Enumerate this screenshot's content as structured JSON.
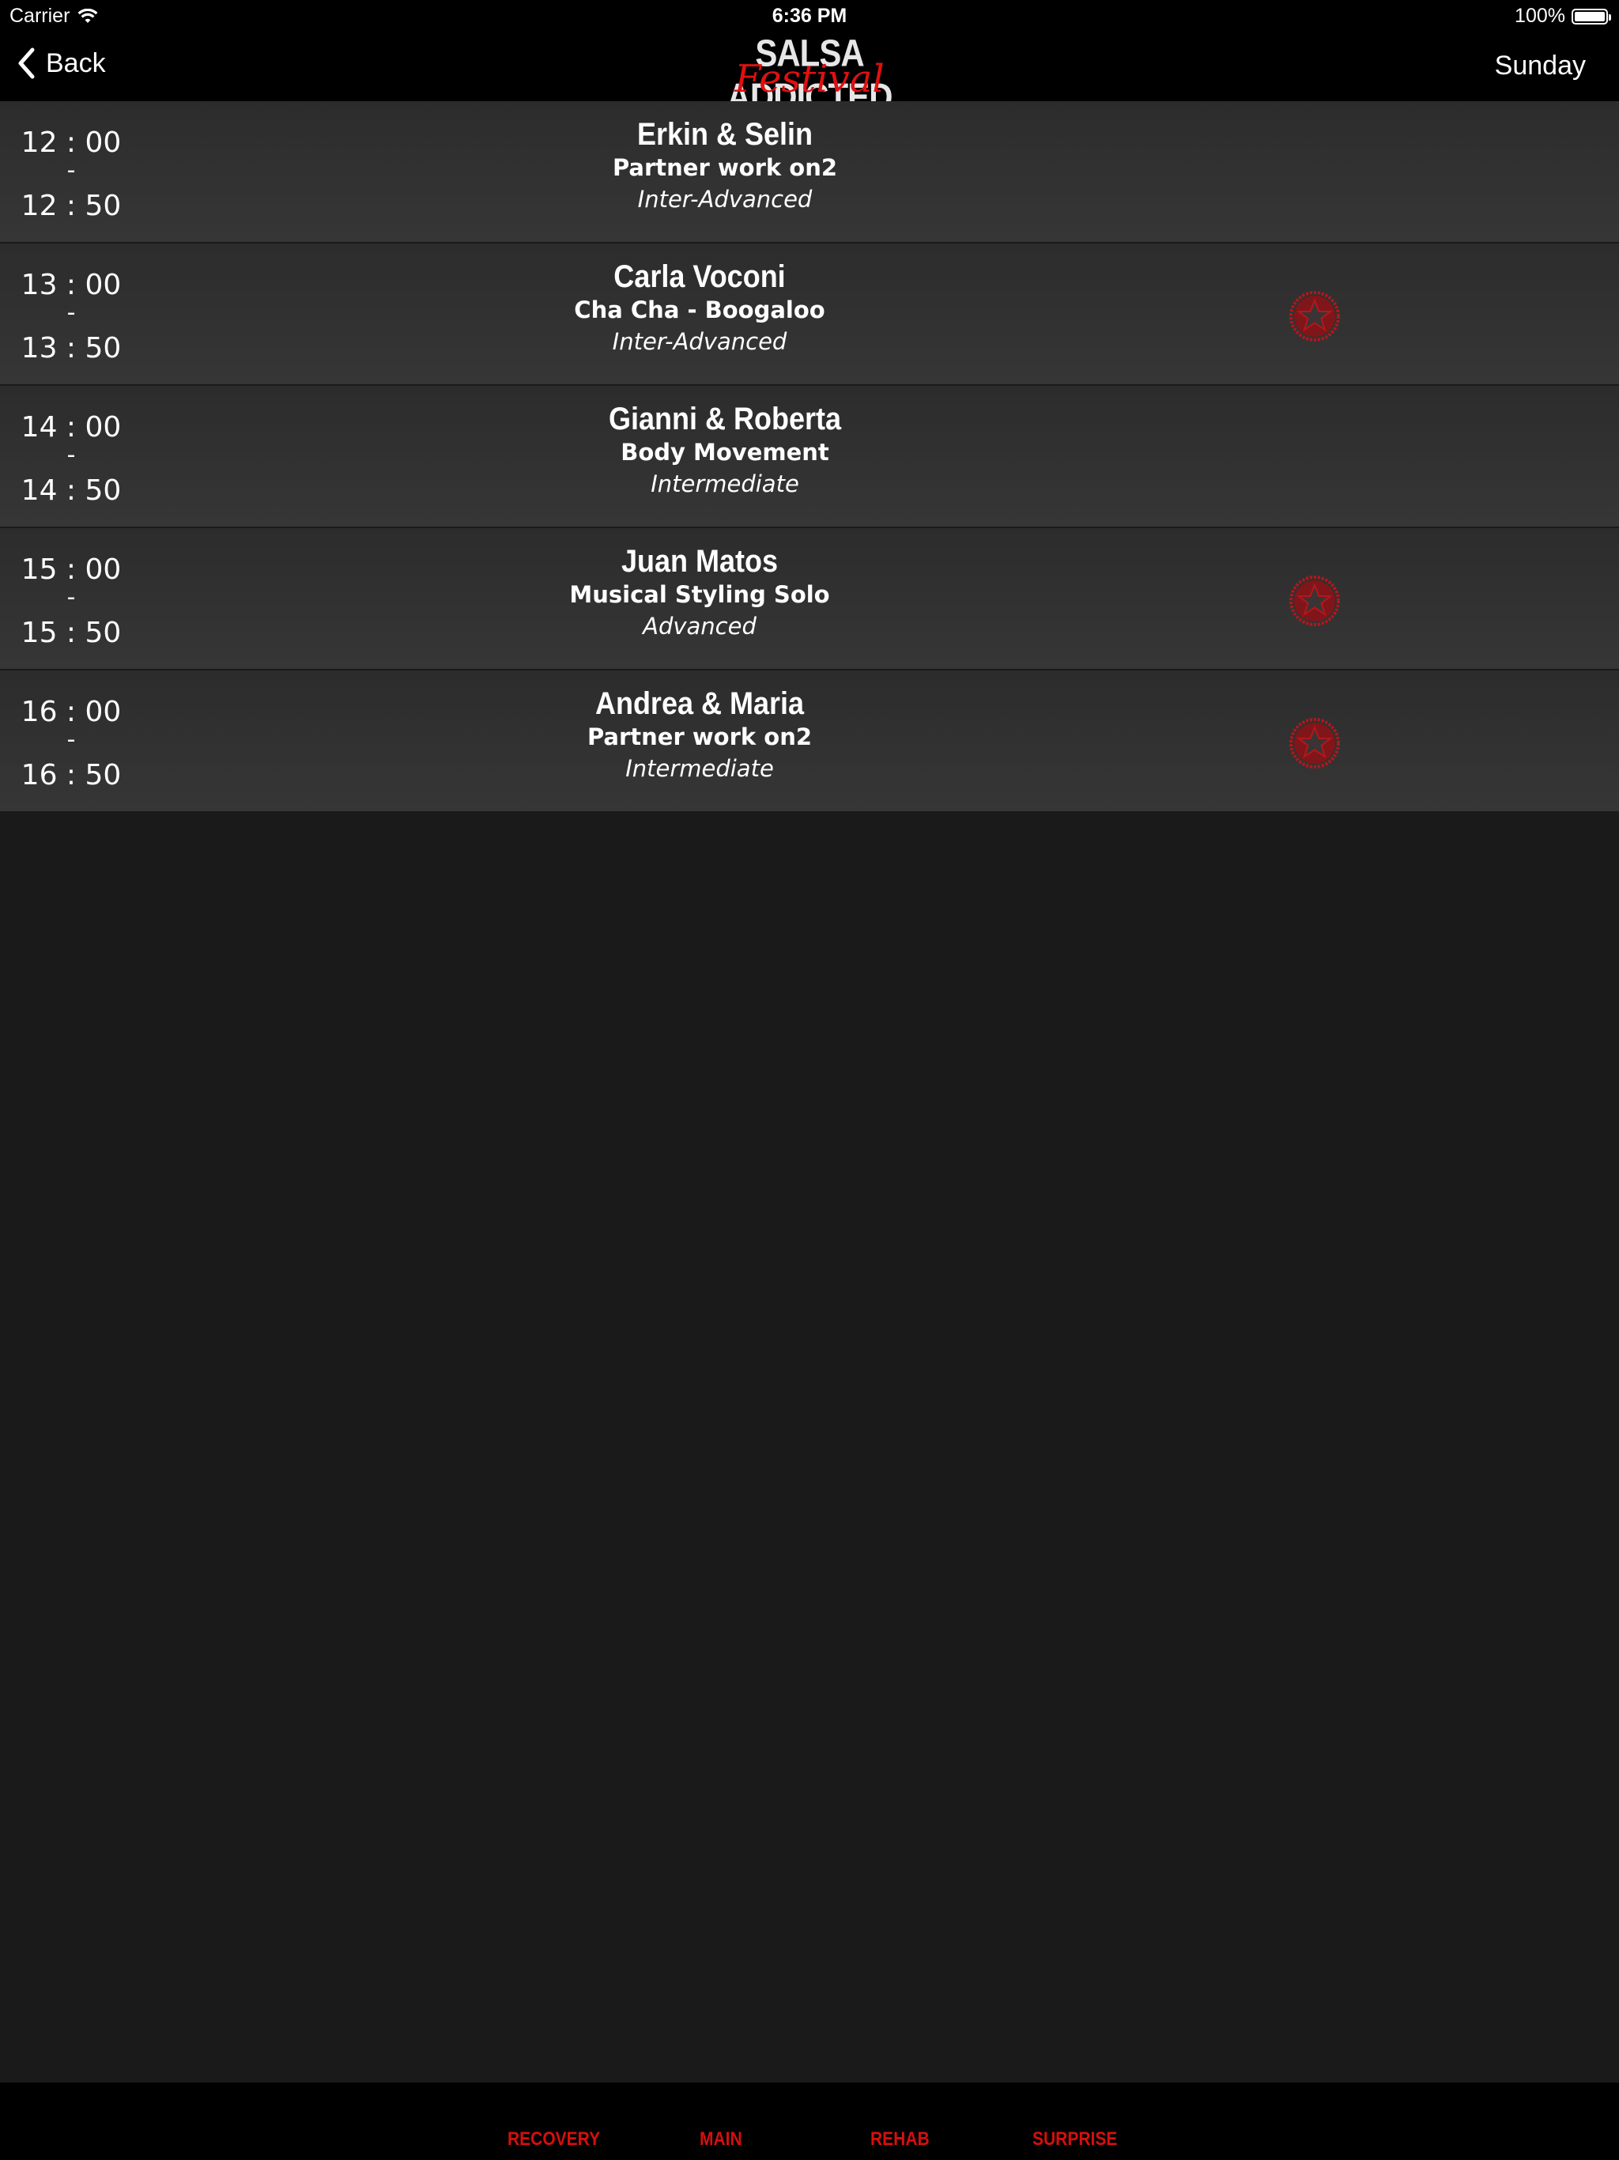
{
  "status_bar": {
    "carrier": "Carrier",
    "time": "6:36 PM",
    "battery": "100%"
  },
  "nav": {
    "back_label": "Back",
    "day": "Sunday",
    "logo_top": "SALSA ADDICTED",
    "logo_bottom": "Festival"
  },
  "sessions": [
    {
      "start": "12 : 00",
      "sep": "-",
      "end": "12 : 50",
      "name": "Erkin & Selin",
      "title": "Partner work on2",
      "level": "Inter-Advanced",
      "favorite": false
    },
    {
      "start": "13 : 00",
      "sep": "-",
      "end": "13 : 50",
      "name": "Carla Voconi",
      "title": "Cha Cha - Boogaloo",
      "level": "Inter-Advanced",
      "favorite": true
    },
    {
      "start": "14 : 00",
      "sep": "-",
      "end": "14 : 50",
      "name": "Gianni & Roberta",
      "title": "Body Movement",
      "level": "Intermediate",
      "favorite": false
    },
    {
      "start": "15 : 00",
      "sep": "-",
      "end": "15 : 50",
      "name": "Juan Matos",
      "title": "Musical Styling Solo",
      "level": "Advanced",
      "favorite": true
    },
    {
      "start": "16 : 00",
      "sep": "-",
      "end": "16 : 50",
      "name": "Andrea & Maria",
      "title": "Partner work on2",
      "level": "Intermediate",
      "favorite": true
    }
  ],
  "tabs": [
    {
      "label": "RECOVERY"
    },
    {
      "label": "MAIN"
    },
    {
      "label": "REHAB"
    },
    {
      "label": "SURPRISE"
    }
  ],
  "icons": {
    "wifi": "wifi-icon",
    "battery": "battery-icon",
    "back": "chevron-left-icon",
    "favorite": "star-badge-icon"
  },
  "colors": {
    "background": "#1b1a1a",
    "bar": "#000000",
    "accent_red": "#d60f0f",
    "row": "#313131"
  }
}
